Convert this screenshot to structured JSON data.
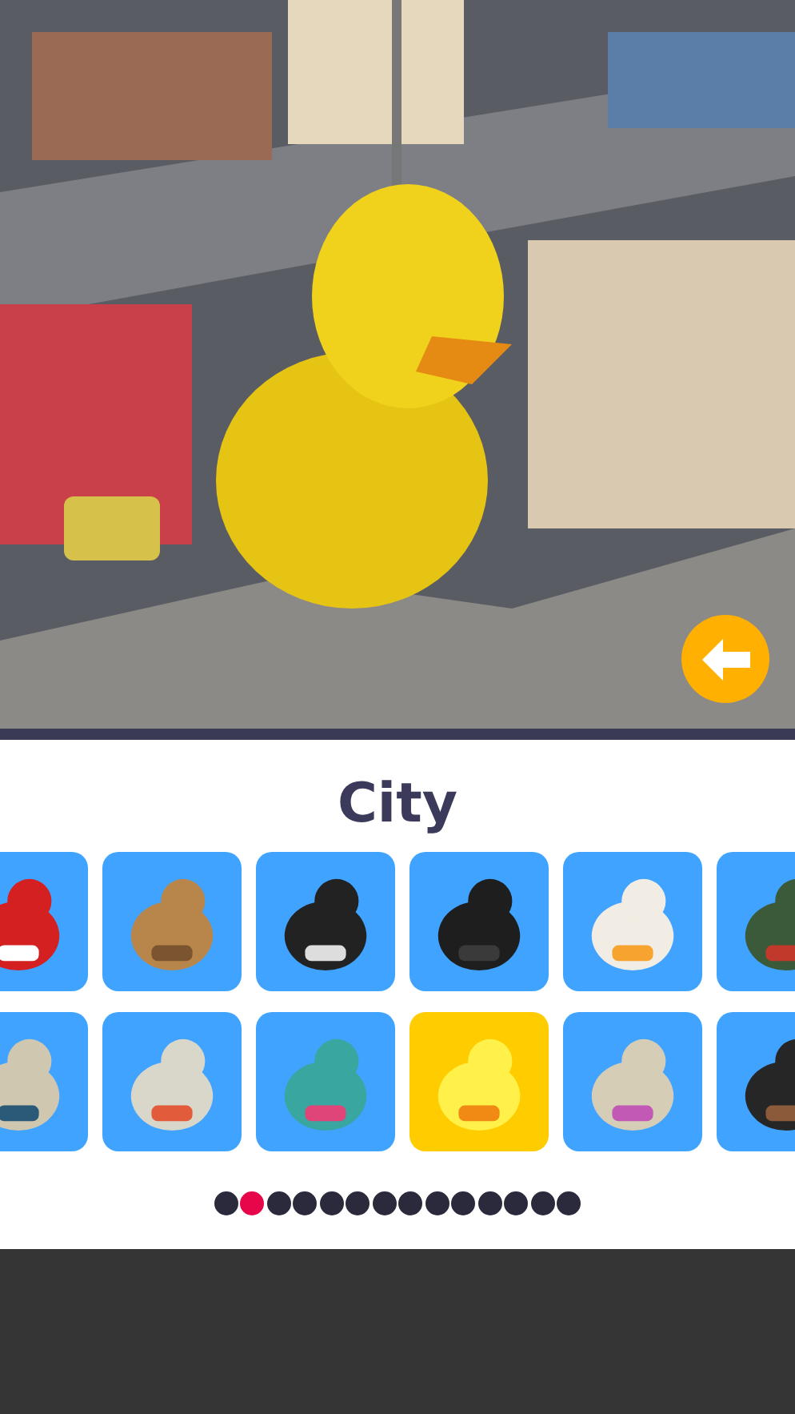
{
  "back_button": {
    "kind": "arrow"
  },
  "category_title": "City",
  "tile_rows": [
    {
      "tiles": [
        {
          "selected": false
        },
        {
          "selected": false
        },
        {
          "selected": false
        },
        {
          "selected": false
        },
        {
          "selected": false
        },
        {
          "selected": false
        }
      ]
    },
    {
      "tiles": [
        {
          "selected": false
        },
        {
          "selected": false
        },
        {
          "selected": false
        },
        {
          "selected": true
        },
        {
          "selected": false
        },
        {
          "selected": false
        }
      ]
    }
  ],
  "pages": [
    {
      "selected": false
    },
    {
      "selected": true
    },
    {
      "selected": false
    },
    {
      "selected": false
    },
    {
      "selected": false
    },
    {
      "selected": false
    },
    {
      "selected": false
    },
    {
      "selected": false
    },
    {
      "selected": false
    },
    {
      "selected": false
    },
    {
      "selected": false
    },
    {
      "selected": false
    },
    {
      "selected": false
    },
    {
      "selected": false
    }
  ]
}
